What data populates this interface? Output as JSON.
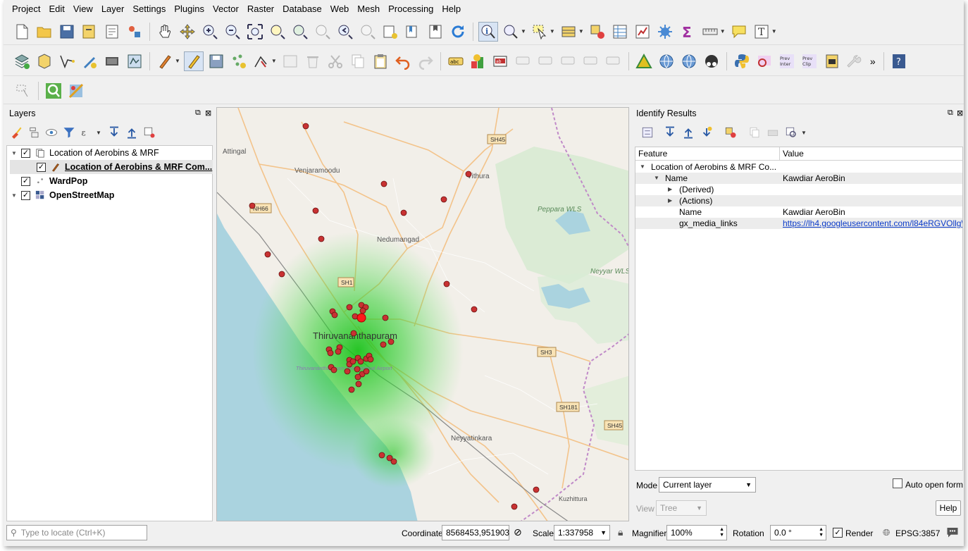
{
  "menubar": {
    "items": [
      "Project",
      "Edit",
      "View",
      "Layer",
      "Settings",
      "Plugins",
      "Vector",
      "Raster",
      "Database",
      "Web",
      "Mesh",
      "Processing",
      "Help"
    ]
  },
  "toolbar_overflow": "»",
  "layers_panel": {
    "title": "Layers",
    "layers": [
      {
        "name": "Location of Aerobins & MRF",
        "checked": "✓"
      },
      {
        "name": "Location of Aerobins & MRF Com...",
        "checked": "✓"
      },
      {
        "name": "WardPop",
        "checked": "✓"
      },
      {
        "name": "OpenStreetMap",
        "checked": "✓"
      }
    ]
  },
  "map": {
    "place_labels": [
      "Attingal",
      "Venjaramoodu",
      "Vithura",
      "Nedumangad",
      "Thiruvananthapuram",
      "Thiruvananthapuram International Airport",
      "Neyyatinkara",
      "Kuzhittura",
      "Peppara WLS",
      "Neyyar WLS"
    ],
    "road_labels": [
      "SH45",
      "NH66",
      "SH1",
      "SH3",
      "SH181",
      "SH45"
    ],
    "selected_color": "#ff1a1a",
    "point_color": "#c83232",
    "heat_color": "#22cc22"
  },
  "identify": {
    "title": "Identify Results",
    "col_feature": "Feature",
    "col_value": "Value",
    "rows": [
      {
        "feature": "Location of Aerobins & MRF Co...",
        "value": ""
      },
      {
        "feature": "Name",
        "value": "Kawdiar AeroBin"
      },
      {
        "feature": "(Derived)",
        "value": ""
      },
      {
        "feature": "(Actions)",
        "value": ""
      },
      {
        "feature": "Name",
        "value": "Kawdiar AeroBin"
      },
      {
        "feature": "gx_media_links",
        "value": "https://lh4.googleusercontent.com/l84eRGVOllg\\"
      }
    ],
    "mode_label": "Mode",
    "mode_value": "Current layer",
    "view_label": "View",
    "view_value": "Tree",
    "auto_open_label": "Auto open form",
    "help_label": "Help"
  },
  "statusbar": {
    "locate_placeholder": "Type to locate (Ctrl+K)",
    "coordinate_label": "Coordinate",
    "coordinate_value": "8568453,951903",
    "scale_label": "Scale",
    "scale_value": "1:337958",
    "magnifier_label": "Magnifier",
    "magnifier_value": "100%",
    "rotation_label": "Rotation",
    "rotation_value": "0.0 °",
    "render_label": "Render",
    "render_checked": "✓",
    "crs_label": "EPSG:3857"
  }
}
